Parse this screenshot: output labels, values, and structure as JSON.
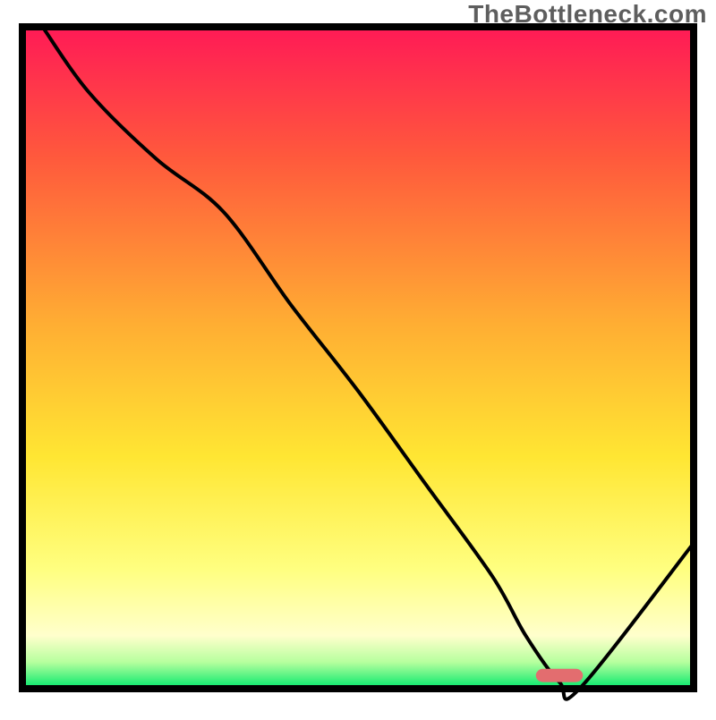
{
  "watermark": "TheBottleneck.com",
  "chart_data": {
    "type": "line",
    "title": "",
    "xlabel": "",
    "ylabel": "",
    "xlim": [
      0,
      100
    ],
    "ylim": [
      0,
      100
    ],
    "x": [
      3,
      10,
      20,
      30,
      40,
      50,
      60,
      70,
      75,
      80,
      83,
      100
    ],
    "y": [
      100,
      90,
      80,
      72,
      58,
      45,
      31,
      17,
      8,
      1,
      0,
      22
    ],
    "marker": {
      "x": 80,
      "y": 2,
      "width": 7,
      "height": 2,
      "color": "#e36d6f"
    },
    "colors": {
      "gradient_top": "#ff1a56",
      "gradient_mid": "#ffcf33",
      "gradient_low": "#ffff99",
      "gradient_bottom": "#00e86b",
      "curve": "#000000",
      "border": "#000000"
    }
  }
}
